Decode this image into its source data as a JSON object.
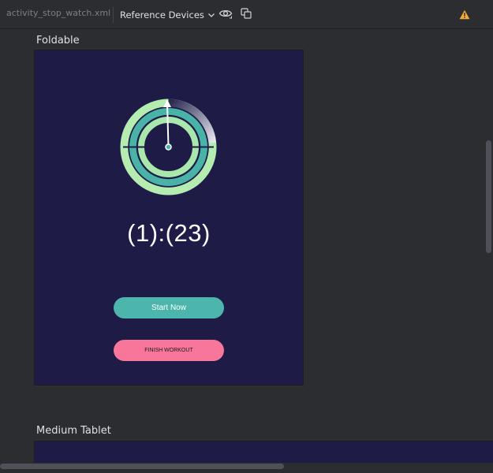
{
  "toolbar": {
    "file_tab": "activity_stop_watch.xml",
    "device_dropdown": "Reference Devices",
    "icons": {
      "dropdown": "chevron-down-icon",
      "visibility": "eye-icon",
      "layout": "copy-icon",
      "warning": "warning-icon"
    }
  },
  "sections": {
    "foldable": "Foldable",
    "medium_tablet": "Medium Tablet"
  },
  "preview": {
    "timer": "(1):(23)",
    "start_button": "Start Now",
    "finish_button": "FINISH WORKOUT"
  },
  "colors": {
    "ide_background": "#2b2d30",
    "device_background": "#1e1b47",
    "start_button": "#4db6ac",
    "finish_button": "#f7769a",
    "ring_light": "#b5ecb0",
    "ring_teal": "#49b3a7",
    "warning": "#f2a93b"
  }
}
